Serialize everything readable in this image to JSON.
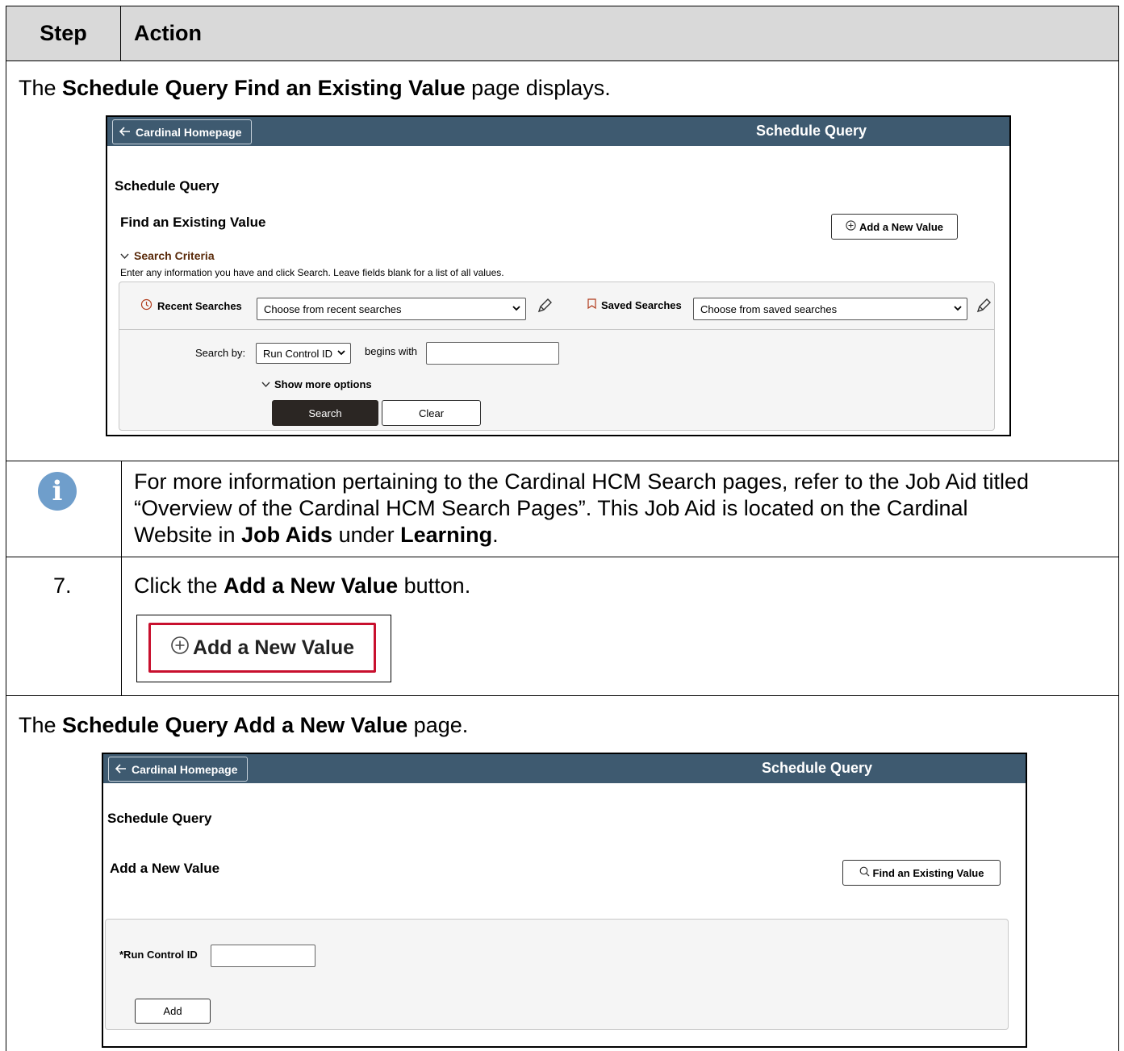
{
  "table": {
    "header": {
      "step": "Step",
      "action": "Action"
    }
  },
  "row1": {
    "text_pre": "The ",
    "text_bold": "Schedule Query Find an Existing Value",
    "text_post": " page displays."
  },
  "screenshot1": {
    "back_label": "Cardinal Homepage",
    "bar_title": "Schedule Query",
    "page_title": "Schedule Query",
    "section_title": "Find an Existing Value",
    "add_button": "Add a New Value",
    "search_criteria": "Search Criteria",
    "instructions": "Enter any information you have and click Search. Leave fields blank for a list of all values.",
    "recent_searches_label": "Recent Searches",
    "recent_searches_value": "Choose from recent searches",
    "saved_searches_label": "Saved Searches",
    "saved_searches_value": "Choose from saved searches",
    "search_by_label": "Search by:",
    "search_by_value": "Run Control ID",
    "begins_with": "begins with",
    "show_more": "Show more options",
    "search_button": "Search",
    "clear_button": "Clear"
  },
  "info_row": {
    "line1": "For more information pertaining to the Cardinal HCM Search pages, refer to the Job Aid titled",
    "line2": "“Overview of the Cardinal HCM Search Pages”.  This Job Aid is located on the Cardinal",
    "line3_pre": "Website in ",
    "line3_bold1": "Job Aids",
    "line3_mid": " under ",
    "line3_bold2": "Learning",
    "line3_post": "."
  },
  "step7": {
    "number": "7.",
    "text_pre": "Click the ",
    "text_bold": "Add a New Value",
    "text_post": " button.",
    "zoom_button": "Add a New Value"
  },
  "row2": {
    "text_pre": "The ",
    "text_bold": "Schedule Query Add a New Value",
    "text_post": " page."
  },
  "screenshot2": {
    "back_label": "Cardinal Homepage",
    "bar_title": "Schedule Query",
    "page_title": "Schedule Query",
    "section_title": "Add a New Value",
    "find_button": "Find an Existing Value",
    "run_control_label": "*Run Control ID",
    "add_button": "Add"
  },
  "colors": {
    "banner": "#3e5a70",
    "header_bg": "#d9d9d9",
    "highlight": "#c8102e",
    "info_icon": "#6f9ecb",
    "search_btn": "#2b2623"
  }
}
